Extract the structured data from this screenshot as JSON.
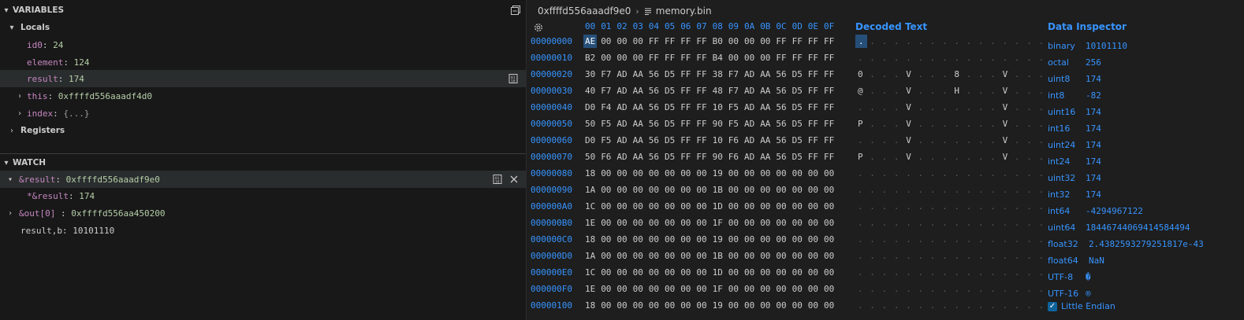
{
  "variables": {
    "title": "VARIABLES",
    "locals_label": "Locals",
    "items": [
      {
        "name": "id0",
        "value": "24"
      },
      {
        "name": "element",
        "value": "124"
      },
      {
        "name": "result",
        "value": "174"
      },
      {
        "name": "this",
        "value": "0xffffd556aaadf4d0"
      },
      {
        "name": "index",
        "value": "{...}"
      }
    ],
    "registers_label": "Registers"
  },
  "watch": {
    "title": "WATCH",
    "items": [
      {
        "name": "&result",
        "value": "0xffffd556aaadf9e0"
      },
      {
        "name": "*&result",
        "value": "174"
      },
      {
        "name": "&out[0]",
        "sep": " : ",
        "value": "0xffffd556aa450200"
      },
      {
        "name": "result,b",
        "value": "10101110"
      }
    ]
  },
  "editor": {
    "breadcrumb_address": "0xffffd556aaadf9e0",
    "breadcrumb_file": "memory.bin",
    "column_headers": [
      "00",
      "01",
      "02",
      "03",
      "04",
      "05",
      "06",
      "07",
      "08",
      "09",
      "0A",
      "0B",
      "0C",
      "0D",
      "0E",
      "0F"
    ],
    "decoded_text_title": "Decoded Text",
    "rows": [
      {
        "address": "00000000",
        "bytes": [
          "AE",
          "00",
          "00",
          "00",
          "FF",
          "FF",
          "FF",
          "FF",
          "B0",
          "00",
          "00",
          "00",
          "FF",
          "FF",
          "FF",
          "FF"
        ],
        "decoded": [
          ".",
          ".",
          ".",
          ".",
          ".",
          ".",
          ".",
          ".",
          ".",
          ".",
          ".",
          ".",
          ".",
          ".",
          ".",
          "."
        ]
      },
      {
        "address": "00000010",
        "bytes": [
          "B2",
          "00",
          "00",
          "00",
          "FF",
          "FF",
          "FF",
          "FF",
          "B4",
          "00",
          "00",
          "00",
          "FF",
          "FF",
          "FF",
          "FF"
        ],
        "decoded": [
          ".",
          ".",
          ".",
          ".",
          ".",
          ".",
          ".",
          ".",
          ".",
          ".",
          ".",
          ".",
          ".",
          ".",
          ".",
          "."
        ]
      },
      {
        "address": "00000020",
        "bytes": [
          "30",
          "F7",
          "AD",
          "AA",
          "56",
          "D5",
          "FF",
          "FF",
          "38",
          "F7",
          "AD",
          "AA",
          "56",
          "D5",
          "FF",
          "FF"
        ],
        "decoded": [
          "0",
          ".",
          ".",
          ".",
          "V",
          ".",
          ".",
          ".",
          "8",
          ".",
          ".",
          ".",
          "V",
          ".",
          ".",
          "."
        ]
      },
      {
        "address": "00000030",
        "bytes": [
          "40",
          "F7",
          "AD",
          "AA",
          "56",
          "D5",
          "FF",
          "FF",
          "48",
          "F7",
          "AD",
          "AA",
          "56",
          "D5",
          "FF",
          "FF"
        ],
        "decoded": [
          "@",
          ".",
          ".",
          ".",
          "V",
          ".",
          ".",
          ".",
          "H",
          ".",
          ".",
          ".",
          "V",
          ".",
          ".",
          "."
        ]
      },
      {
        "address": "00000040",
        "bytes": [
          "D0",
          "F4",
          "AD",
          "AA",
          "56",
          "D5",
          "FF",
          "FF",
          "10",
          "F5",
          "AD",
          "AA",
          "56",
          "D5",
          "FF",
          "FF"
        ],
        "decoded": [
          ".",
          ".",
          ".",
          ".",
          "V",
          ".",
          ".",
          ".",
          ".",
          ".",
          ".",
          ".",
          "V",
          ".",
          ".",
          "."
        ]
      },
      {
        "address": "00000050",
        "bytes": [
          "50",
          "F5",
          "AD",
          "AA",
          "56",
          "D5",
          "FF",
          "FF",
          "90",
          "F5",
          "AD",
          "AA",
          "56",
          "D5",
          "FF",
          "FF"
        ],
        "decoded": [
          "P",
          ".",
          ".",
          ".",
          "V",
          ".",
          ".",
          ".",
          ".",
          ".",
          ".",
          ".",
          "V",
          ".",
          ".",
          "."
        ]
      },
      {
        "address": "00000060",
        "bytes": [
          "D0",
          "F5",
          "AD",
          "AA",
          "56",
          "D5",
          "FF",
          "FF",
          "10",
          "F6",
          "AD",
          "AA",
          "56",
          "D5",
          "FF",
          "FF"
        ],
        "decoded": [
          ".",
          ".",
          ".",
          ".",
          "V",
          ".",
          ".",
          ".",
          ".",
          ".",
          ".",
          ".",
          "V",
          ".",
          ".",
          "."
        ]
      },
      {
        "address": "00000070",
        "bytes": [
          "50",
          "F6",
          "AD",
          "AA",
          "56",
          "D5",
          "FF",
          "FF",
          "90",
          "F6",
          "AD",
          "AA",
          "56",
          "D5",
          "FF",
          "FF"
        ],
        "decoded": [
          "P",
          ".",
          ".",
          ".",
          "V",
          ".",
          ".",
          ".",
          ".",
          ".",
          ".",
          ".",
          "V",
          ".",
          ".",
          "."
        ]
      },
      {
        "address": "00000080",
        "bytes": [
          "18",
          "00",
          "00",
          "00",
          "00",
          "00",
          "00",
          "00",
          "19",
          "00",
          "00",
          "00",
          "00",
          "00",
          "00",
          "00"
        ],
        "decoded": [
          ".",
          ".",
          ".",
          ".",
          ".",
          ".",
          ".",
          ".",
          ".",
          ".",
          ".",
          ".",
          ".",
          ".",
          ".",
          "."
        ]
      },
      {
        "address": "00000090",
        "bytes": [
          "1A",
          "00",
          "00",
          "00",
          "00",
          "00",
          "00",
          "00",
          "1B",
          "00",
          "00",
          "00",
          "00",
          "00",
          "00",
          "00"
        ],
        "decoded": [
          ".",
          ".",
          ".",
          ".",
          ".",
          ".",
          ".",
          ".",
          ".",
          ".",
          ".",
          ".",
          ".",
          ".",
          ".",
          "."
        ]
      },
      {
        "address": "000000A0",
        "bytes": [
          "1C",
          "00",
          "00",
          "00",
          "00",
          "00",
          "00",
          "00",
          "1D",
          "00",
          "00",
          "00",
          "00",
          "00",
          "00",
          "00"
        ],
        "decoded": [
          ".",
          ".",
          ".",
          ".",
          ".",
          ".",
          ".",
          ".",
          ".",
          ".",
          ".",
          ".",
          ".",
          ".",
          ".",
          "."
        ]
      },
      {
        "address": "000000B0",
        "bytes": [
          "1E",
          "00",
          "00",
          "00",
          "00",
          "00",
          "00",
          "00",
          "1F",
          "00",
          "00",
          "00",
          "00",
          "00",
          "00",
          "00"
        ],
        "decoded": [
          ".",
          ".",
          ".",
          ".",
          ".",
          ".",
          ".",
          ".",
          ".",
          ".",
          ".",
          ".",
          ".",
          ".",
          ".",
          "."
        ]
      },
      {
        "address": "000000C0",
        "bytes": [
          "18",
          "00",
          "00",
          "00",
          "00",
          "00",
          "00",
          "00",
          "19",
          "00",
          "00",
          "00",
          "00",
          "00",
          "00",
          "00"
        ],
        "decoded": [
          ".",
          ".",
          ".",
          ".",
          ".",
          ".",
          ".",
          ".",
          ".",
          ".",
          ".",
          ".",
          ".",
          ".",
          ".",
          "."
        ]
      },
      {
        "address": "000000D0",
        "bytes": [
          "1A",
          "00",
          "00",
          "00",
          "00",
          "00",
          "00",
          "00",
          "1B",
          "00",
          "00",
          "00",
          "00",
          "00",
          "00",
          "00"
        ],
        "decoded": [
          ".",
          ".",
          ".",
          ".",
          ".",
          ".",
          ".",
          ".",
          ".",
          ".",
          ".",
          ".",
          ".",
          ".",
          ".",
          "."
        ]
      },
      {
        "address": "000000E0",
        "bytes": [
          "1C",
          "00",
          "00",
          "00",
          "00",
          "00",
          "00",
          "00",
          "1D",
          "00",
          "00",
          "00",
          "00",
          "00",
          "00",
          "00"
        ],
        "decoded": [
          ".",
          ".",
          ".",
          ".",
          ".",
          ".",
          ".",
          ".",
          ".",
          ".",
          ".",
          ".",
          ".",
          ".",
          ".",
          "."
        ]
      },
      {
        "address": "000000F0",
        "bytes": [
          "1E",
          "00",
          "00",
          "00",
          "00",
          "00",
          "00",
          "00",
          "1F",
          "00",
          "00",
          "00",
          "00",
          "00",
          "00",
          "00"
        ],
        "decoded": [
          ".",
          ".",
          ".",
          ".",
          ".",
          ".",
          ".",
          ".",
          ".",
          ".",
          ".",
          ".",
          ".",
          ".",
          ".",
          "."
        ]
      },
      {
        "address": "00000100",
        "bytes": [
          "18",
          "00",
          "00",
          "00",
          "00",
          "00",
          "00",
          "00",
          "19",
          "00",
          "00",
          "00",
          "00",
          "00",
          "00",
          "00"
        ],
        "decoded": [
          ".",
          ".",
          ".",
          ".",
          ".",
          ".",
          ".",
          ".",
          ".",
          ".",
          ".",
          ".",
          ".",
          ".",
          ".",
          "."
        ]
      }
    ]
  },
  "inspector": {
    "title": "Data Inspector",
    "rows": [
      {
        "label": "binary",
        "value": "10101110"
      },
      {
        "label": "octal",
        "value": "256"
      },
      {
        "label": "uint8",
        "value": "174"
      },
      {
        "label": "int8",
        "value": "-82"
      },
      {
        "label": "uint16",
        "value": "174"
      },
      {
        "label": "int16",
        "value": "174"
      },
      {
        "label": "uint24",
        "value": "174"
      },
      {
        "label": "int24",
        "value": "174"
      },
      {
        "label": "uint32",
        "value": "174"
      },
      {
        "label": "int32",
        "value": "174"
      },
      {
        "label": "int64",
        "value": "-4294967122"
      },
      {
        "label": "uint64",
        "value": "18446744069414584494"
      },
      {
        "label": "float32",
        "value": "2.4382593279251817e-43"
      },
      {
        "label": "float64",
        "value": "NaN"
      },
      {
        "label": "UTF-8",
        "value": "�"
      },
      {
        "label": "UTF-16",
        "value": "®"
      }
    ],
    "little_endian_label": "Little Endian",
    "little_endian_checked": true
  }
}
